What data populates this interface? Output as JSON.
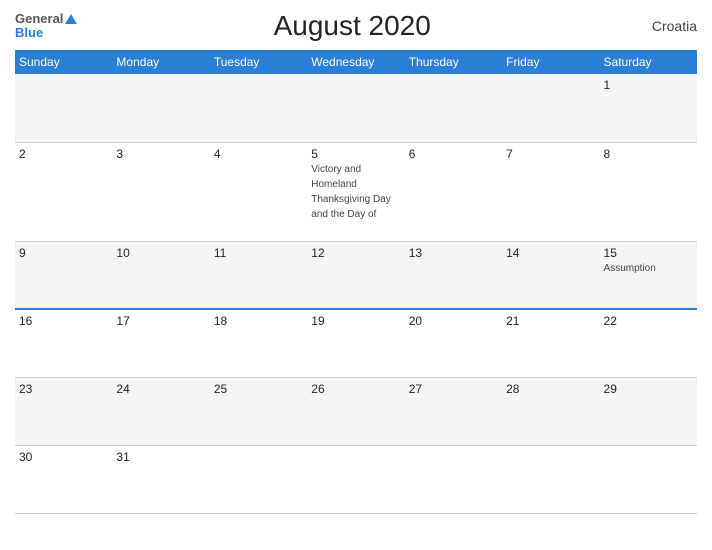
{
  "header": {
    "logo_general": "General",
    "logo_blue": "Blue",
    "title": "August 2020",
    "country": "Croatia"
  },
  "weekdays": [
    "Sunday",
    "Monday",
    "Tuesday",
    "Wednesday",
    "Thursday",
    "Friday",
    "Saturday"
  ],
  "rows": [
    {
      "cells": [
        "",
        "",
        "",
        "",
        "",
        "",
        "1"
      ],
      "holiday": {
        "col": -1,
        "text": ""
      }
    },
    {
      "cells": [
        "2",
        "3",
        "4",
        "5",
        "6",
        "7",
        "8"
      ],
      "holiday": {
        "col": 3,
        "text": "Victory and Homeland Thanksgiving Day and the Day of"
      }
    },
    {
      "cells": [
        "9",
        "10",
        "11",
        "12",
        "13",
        "14",
        "15"
      ],
      "holiday": {
        "col": 6,
        "text": "Assumption"
      },
      "blue_border": true
    },
    {
      "cells": [
        "16",
        "17",
        "18",
        "19",
        "20",
        "21",
        "22"
      ],
      "holiday": {
        "col": -1,
        "text": ""
      }
    },
    {
      "cells": [
        "23",
        "24",
        "25",
        "26",
        "27",
        "28",
        "29"
      ],
      "holiday": {
        "col": -1,
        "text": ""
      }
    },
    {
      "cells": [
        "30",
        "31",
        "",
        "",
        "",
        "",
        ""
      ],
      "holiday": {
        "col": -1,
        "text": ""
      },
      "last": true
    }
  ]
}
